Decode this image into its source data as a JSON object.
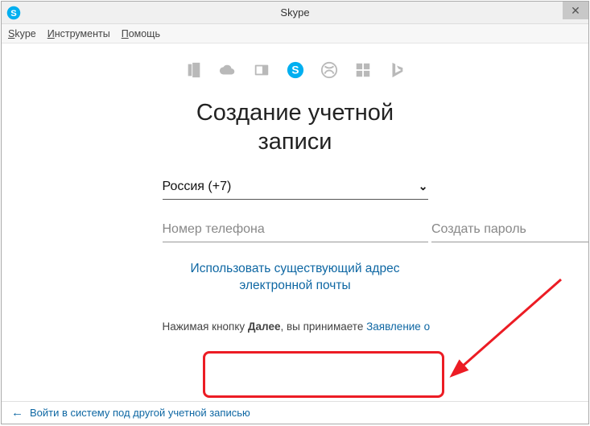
{
  "titlebar": {
    "title": "Skype"
  },
  "menubar": {
    "skype": "Skype",
    "tools": "Инструменты",
    "help": "Помощь"
  },
  "heading_line1": "Создание учетной",
  "heading_line2": "записи",
  "form": {
    "country": "Россия (+7)",
    "phone_placeholder": "Номер телефона",
    "password_placeholder": "Создать пароль"
  },
  "use_email_line1": "Использовать существующий адрес",
  "use_email_line2": "электронной почты",
  "agree_prefix": "Нажимая кнопку ",
  "agree_bold": "Далее",
  "agree_mid": ", вы принимаете ",
  "agree_link": "Заявление о",
  "bottom_link": "Войти в систему под другой учетной записью"
}
